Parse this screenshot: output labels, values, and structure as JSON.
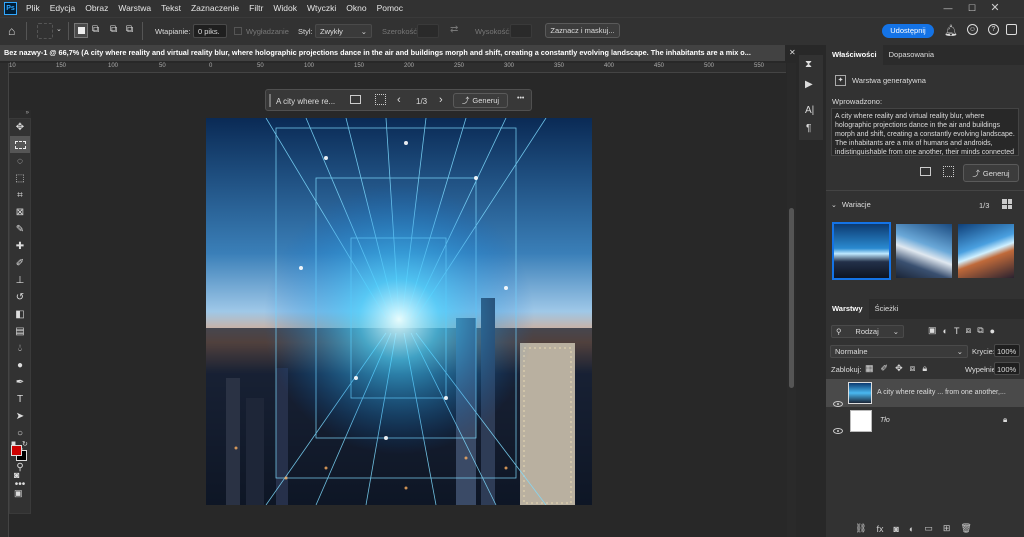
{
  "menubar": {
    "app_icon": "Ps",
    "items": [
      "Plik",
      "Edycja",
      "Obraz",
      "Warstwa",
      "Tekst",
      "Zaznaczenie",
      "Filtr",
      "Widok",
      "Wtyczki",
      "Okno",
      "Pomoc"
    ]
  },
  "optbar": {
    "feather_label": "Wtapianie:",
    "feather_value": "0 piks.",
    "antialias_label": "Wygładzanie",
    "style_label": "Styl:",
    "style_value": "Zwykły",
    "width_label": "Szerokość:",
    "height_label": "Wysokość:",
    "select_mask_label": "Zaznacz i maskuj...",
    "share_label": "Udostępnij"
  },
  "document": {
    "tab_title": "Bez nazwy-1 @ 66,7% (A city where reality and virtual reality blur, where holographic projections dance in the air and buildings morph and shift, creating a constantly evolving landscape. The inhabitants are a mix o...",
    "ruler_ticks": [
      "10",
      "150",
      "100",
      "50",
      "0",
      "50",
      "100",
      "150",
      "200",
      "250",
      "300",
      "350",
      "400",
      "450",
      "500",
      "550"
    ]
  },
  "contextbar": {
    "prompt_preview": "A city where re...",
    "page_indicator": "1/3",
    "generate_label": "Generuj",
    "more_label": "•••"
  },
  "properties": {
    "tabs": [
      "Właściwości",
      "Dopasowania"
    ],
    "layer_type": "Warstwa generatywna",
    "prompt_heading": "Wprowadzono:",
    "prompt_text": "A city where reality and virtual reality blur, where holographic projections dance in the air and buildings morph and shift, creating a constantly evolving landscape. The inhabitants are a mix of humans and androids, indistinguishable from one another, their minds connected to a vast network of information.",
    "generate_label": "Generuj",
    "variations_label": "Wariacje",
    "variations_count": "1/3"
  },
  "layers": {
    "tabs": [
      "Warstwy",
      "Ścieżki"
    ],
    "filter_value": "Rodzaj",
    "blend_mode": "Normalne",
    "opacity_label": "Krycie:",
    "opacity_value": "100%",
    "lock_label": "Zablokuj:",
    "fill_label": "Wypełnienie:",
    "fill_value": "100%",
    "items": [
      {
        "name": "A city where reality ... from one another,...",
        "selected": true
      },
      {
        "name": "Tło",
        "selected": false
      }
    ]
  },
  "colors": {
    "accent": "#1473e6",
    "foreground": "#cc0000",
    "background": "#000000"
  }
}
